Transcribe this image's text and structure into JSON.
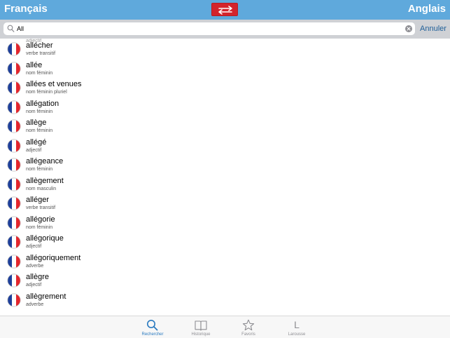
{
  "header": {
    "source_language": "Français",
    "target_language": "Anglais",
    "swap_icon": "swap-arrows-icon"
  },
  "search": {
    "value": "All",
    "cancel_label": "Annuler"
  },
  "list_top_partial": {
    "pos": "adjectif"
  },
  "entries": [
    {
      "word": "allécher",
      "pos": "verbe transitif"
    },
    {
      "word": "allée",
      "pos": "nom féminin"
    },
    {
      "word": "allées et venues",
      "pos": "nom féminin pluriel"
    },
    {
      "word": "allégation",
      "pos": "nom féminin"
    },
    {
      "word": "allège",
      "pos": "nom féminin"
    },
    {
      "word": "allégé",
      "pos": "adjectif"
    },
    {
      "word": "allégeance",
      "pos": "nom féminin"
    },
    {
      "word": "allègement",
      "pos": "nom masculin"
    },
    {
      "word": "alléger",
      "pos": "verbe transitif"
    },
    {
      "word": "allégorie",
      "pos": "nom féminin"
    },
    {
      "word": "allégorique",
      "pos": "adjectif"
    },
    {
      "word": "allégoriquement",
      "pos": "adverbe"
    },
    {
      "word": "allègre",
      "pos": "adjectif"
    },
    {
      "word": "allègrement",
      "pos": "adverbe"
    }
  ],
  "tabs": [
    {
      "label": "Rechercher",
      "icon": "search-icon",
      "active": true
    },
    {
      "label": "Historique",
      "icon": "book-icon",
      "active": false
    },
    {
      "label": "Favoris",
      "icon": "star-icon",
      "active": false
    },
    {
      "label": "Larousse",
      "icon": "larousse-l-icon",
      "glyph": "L",
      "active": false
    }
  ],
  "colors": {
    "header_bg": "#5fa9dc",
    "swap_button": "#d3242c",
    "accent": "#2a7ac0",
    "flag_blue": "#1d3f9a",
    "flag_red": "#e3262d"
  }
}
